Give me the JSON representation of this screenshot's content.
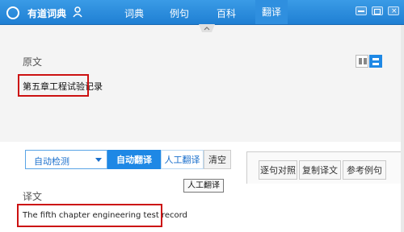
{
  "titlebar": {
    "app_name": "有道词典",
    "tabs": [
      {
        "label": "词典",
        "active": false
      },
      {
        "label": "例句",
        "active": false
      },
      {
        "label": "百科",
        "active": false
      },
      {
        "label": "翻译",
        "active": true
      }
    ]
  },
  "origin": {
    "label": "原文",
    "text": "第五章工程试验记录"
  },
  "toolbar": {
    "language_select": "自动检测",
    "auto_translate": "自动翻译",
    "human_translate": "人工翻译",
    "clear": "清空",
    "compare": "逐句对照",
    "copy": "复制译文",
    "reference": "参考例句",
    "tooltip": "人工翻译"
  },
  "translation": {
    "label": "译文",
    "text": "The fifth chapter engineering test record"
  },
  "colors": {
    "accent": "#1e88e5",
    "highlight_box": "#cc1111"
  }
}
